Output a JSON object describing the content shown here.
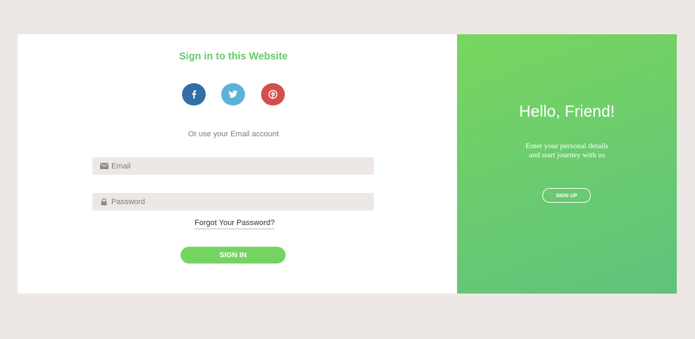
{
  "signin": {
    "title": "Sign in to this Website",
    "social": [
      {
        "name": "facebook-icon",
        "color": "#336fa7"
      },
      {
        "name": "twitter-icon",
        "color": "#5bb3d8"
      },
      {
        "name": "pinterest-icon",
        "color": "#d34f4c"
      }
    ],
    "alt_text": "Or use your Email account",
    "email": {
      "value": "",
      "placeholder": "Email",
      "icon": "envelope-icon"
    },
    "password": {
      "value": "",
      "placeholder": "Password",
      "icon": "lock-icon"
    },
    "forgot_label": "Forgot Your Password?",
    "button_label": "SIGN IN",
    "accent_color": "#66c86a"
  },
  "panel": {
    "title": "Hello, Friend!",
    "tagline_line1": "Enter your personal details",
    "tagline_line2": "and start journey with us",
    "button_label": "SIGN UP",
    "gradient": [
      "#78d65e",
      "#60c27c"
    ]
  },
  "colors": {
    "background": "#ede8e5",
    "card": "#ffffff",
    "field": "#ede8e6"
  }
}
